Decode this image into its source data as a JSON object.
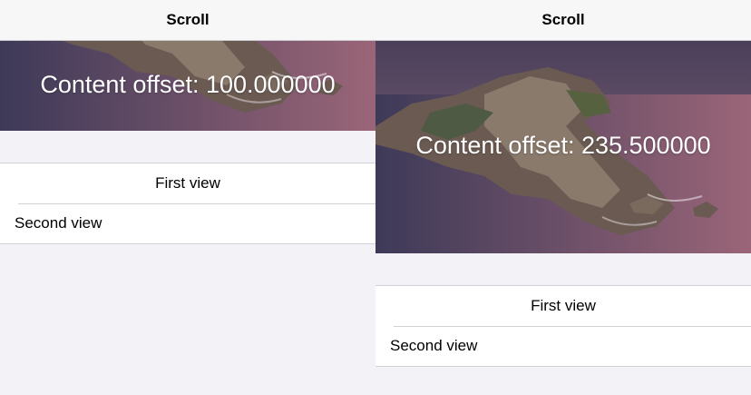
{
  "screens": [
    {
      "nav": {
        "title": "Scroll"
      },
      "content_offset_label": "Content offset: 100.000000",
      "rows": [
        {
          "label": "First view"
        },
        {
          "label": "Second view"
        }
      ]
    },
    {
      "nav": {
        "title": "Scroll"
      },
      "content_offset_label": "Content offset: 235.500000",
      "rows": [
        {
          "label": "First view"
        },
        {
          "label": "Second view"
        }
      ]
    }
  ],
  "colors": {
    "nav_background": "#f7f7f7",
    "page_background": "#f2f2f7",
    "cell_background": "#ffffff",
    "separator": "#d1d1d6"
  }
}
